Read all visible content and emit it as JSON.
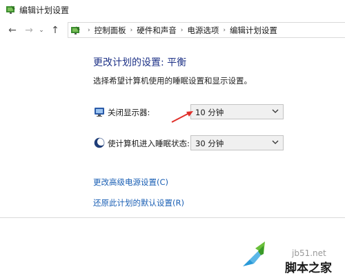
{
  "window": {
    "title": "编辑计划设置"
  },
  "nav": {
    "back_glyph": "←",
    "forward_glyph": "→",
    "recent_glyph": "⌄",
    "up_glyph": "↑",
    "breadcrumb": [
      "控制面板",
      "硬件和声音",
      "电源选项",
      "编辑计划设置"
    ],
    "separator": "›"
  },
  "main": {
    "title": "更改计划的设置: 平衡",
    "subtitle": "选择希望计算机使用的睡眠设置和显示设置。",
    "settings": [
      {
        "label": "关闭显示器:",
        "value": "10 分钟",
        "icon": "monitor-icon"
      },
      {
        "label": "使计算机进入睡眠状态:",
        "value": "30 分钟",
        "icon": "moon-icon"
      }
    ],
    "links": {
      "advanced": "更改高级电源设置(C)",
      "restore": "还原此计划的默认设置(R)"
    }
  },
  "watermark": {
    "domain": "jb51.net",
    "brand": "脚本之家"
  },
  "colors": {
    "title": "#1e3287",
    "link": "#1a5fb4",
    "arrow": "#e0302b",
    "dropdown_bg": "#f0f0f0"
  }
}
